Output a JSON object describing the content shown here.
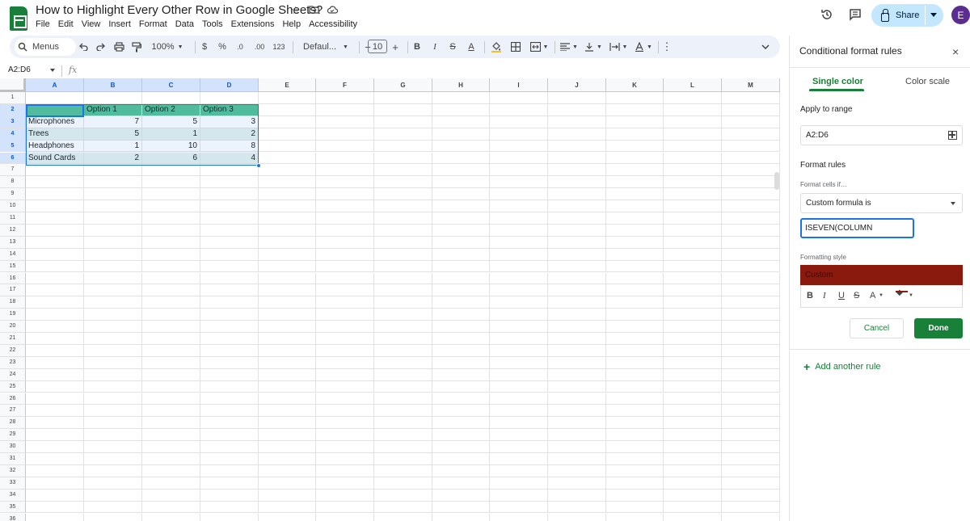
{
  "doc": {
    "title": "How to Highlight Every Other Row in Google Sheets?"
  },
  "menu": [
    "File",
    "Edit",
    "View",
    "Insert",
    "Format",
    "Data",
    "Tools",
    "Extensions",
    "Help",
    "Accessibility"
  ],
  "header": {
    "share_label": "Share",
    "avatar_initial": "E"
  },
  "toolbar": {
    "menus_label": "Menus",
    "zoom": "100%",
    "currency": "$",
    "percent": "%",
    "dec_decrease": ".0",
    "dec_increase": ".00",
    "number_format": "123",
    "font": "Defaul...",
    "font_size": "10",
    "minus": "−",
    "plus": "+",
    "bold": "B",
    "italic": "I",
    "strike": "S",
    "text_color": "A",
    "more": "⋮"
  },
  "formula_bar": {
    "name_box": "A2:D6",
    "fx": "fx"
  },
  "sheet": {
    "columns": [
      "A",
      "B",
      "C",
      "D",
      "E",
      "F",
      "G",
      "H",
      "I",
      "J",
      "K",
      "L",
      "M"
    ],
    "rows": [
      "1",
      "2",
      "3",
      "4",
      "5",
      "6",
      "7",
      "8",
      "9",
      "10",
      "11",
      "12",
      "13",
      "14",
      "15",
      "16",
      "17",
      "18",
      "19",
      "20",
      "21",
      "22",
      "23",
      "24",
      "25",
      "26",
      "27",
      "28",
      "29",
      "30",
      "31",
      "32",
      "33",
      "34",
      "35",
      "36"
    ],
    "header_row": [
      "",
      "Option 1",
      "Option 2",
      "Option 3"
    ],
    "data_rows": [
      [
        "Microphones",
        "7",
        "5",
        "3"
      ],
      [
        "Trees",
        "5",
        "1",
        "2"
      ],
      [
        "Headphones",
        "1",
        "10",
        "8"
      ],
      [
        "Sound Cards",
        "2",
        "6",
        "4"
      ]
    ]
  },
  "panel": {
    "title": "Conditional format rules",
    "close": "×",
    "tab_single": "Single color",
    "tab_scale": "Color scale",
    "apply_label": "Apply to range",
    "range_value": "A2:D6",
    "format_rules_label": "Format rules",
    "format_cells_if": "Format cells if…",
    "condition": "Custom formula is",
    "formula_value": "ISEVEN(COLUMN",
    "formatting_style_label": "Formatting style",
    "style_name": "Custom",
    "style_tools": {
      "bold": "B",
      "italic": "I",
      "underline": "U",
      "strike": "S",
      "text_color": "A",
      "fill": "◆"
    },
    "cancel": "Cancel",
    "done": "Done",
    "add_rule": "Add another rule"
  },
  "colors": {
    "accent_green": "#188038",
    "header_fill": "#56c497",
    "band_fill": "#e4f2ee",
    "custom_fill": "#8b1a0e",
    "selection_blue": "#1a73e8"
  }
}
